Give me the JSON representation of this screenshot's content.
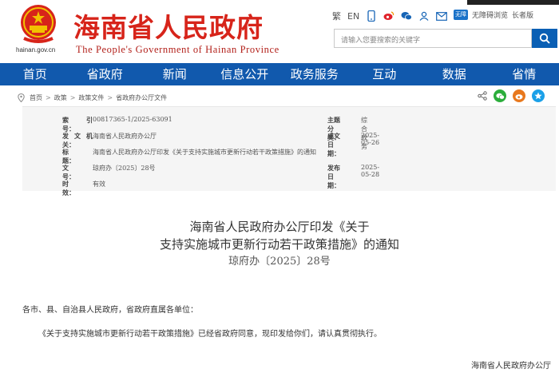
{
  "header": {
    "title": "海南省人民政府",
    "subtitle": "The People's Government  of Hainan Province",
    "domain": "hainan.gov.cn",
    "tools": {
      "traditional": "繁",
      "english": "EN",
      "accessible_box_text": "无障碍",
      "accessible": "无障碍浏览",
      "elderly": "长者版"
    },
    "search_placeholder": "请输入您要搜索的关键字"
  },
  "nav": {
    "items": [
      "首页",
      "省政府",
      "新闻",
      "信息公开",
      "政务服务",
      "互动",
      "数据",
      "省情"
    ]
  },
  "breadcrumb": [
    "首页",
    "政策",
    "政策文件",
    "省政府办公厅文件"
  ],
  "meta": {
    "index_label": "索　引　号：",
    "index_value": "00817365-1/2025-63091",
    "category_label": "主题分类：",
    "category_value": "综合政务",
    "issuer_label": "发文机关：",
    "issuer_value": "海南省人民政府办公厅",
    "created_label": "成文日期：",
    "created_value": "2025-05-26",
    "subject_label": "标　　题：",
    "subject_value": "海南省人民政府办公厅印发《关于支持实施城市更新行动若干政策措施》的通知",
    "docno_label": "文　　号：",
    "docno_value": "琼府办〔2025〕28号",
    "published_label": "发布日期：",
    "published_value": "2025-05-28",
    "validity_label": "时　　效：",
    "validity_value": "有效"
  },
  "article": {
    "title_line1": "海南省人民政府办公厅印发《关于",
    "title_line2": "支持实施城市更新行动若干政策措施》的通知",
    "doc_number": "琼府办〔2025〕28号",
    "addressee": "各市、县、自治县人民政府，省政府直属各单位：",
    "body": "《关于支持实施城市更新行动若干政策措施》已经省政府同意，现印发给你们，请认真贯彻执行。",
    "signature": "海南省人民政府办公厅"
  },
  "colors": {
    "brand_red": "#d7241a",
    "nav_blue": "#1159ad",
    "wechat_green": "#2bad3b",
    "weibo_orange": "#e8781d",
    "qq_blue": "#1aa0e8"
  }
}
